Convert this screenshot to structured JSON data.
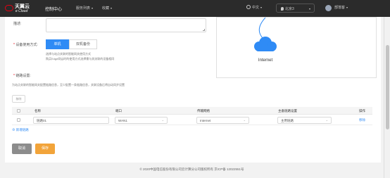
{
  "brand": {
    "name_cn": "天翼云",
    "name_en": "e Cloud"
  },
  "header": {
    "console": "控制中心",
    "nav": [
      {
        "label": "服务列表"
      },
      {
        "label": "收藏"
      }
    ],
    "language": "中文",
    "region": "北京3",
    "user": "部落客"
  },
  "form": {
    "description_label": "描述:",
    "device_mode": {
      "label": "设备使用方式:",
      "options": [
        {
          "label": "单机"
        },
        {
          "label": "双机备份"
        }
      ],
      "selected": "单机",
      "hints": [
        "选择与站点关联的智能网关使用方式",
        "购买Edge网云时的使用方式选择需与其关联的设备相同"
      ]
    },
    "link": {
      "title": "链路设置:",
      "hint": "为站点关联的智能网关配置链路信息，至少配置一条链路信息，关联设备后将自动同步设置",
      "delete_button": "移除"
    },
    "table": {
      "columns": [
        "名称",
        "端口",
        "传输网络",
        "主备链路设置",
        "操作"
      ],
      "rows": [
        {
          "name": "链路01",
          "port": "WAN1",
          "network": "Internet",
          "role": "主用链路",
          "action": "移除"
        }
      ],
      "add_link": "新增链路"
    },
    "cancel": "取消",
    "save": "保存"
  },
  "diagram": {
    "label": "Internet",
    "cloud_color": "#2f8bf5"
  },
  "footer": {
    "text": "© 2020中国电信股份有限公司云计算分公司版权所有 京ICP备 12022551号"
  }
}
